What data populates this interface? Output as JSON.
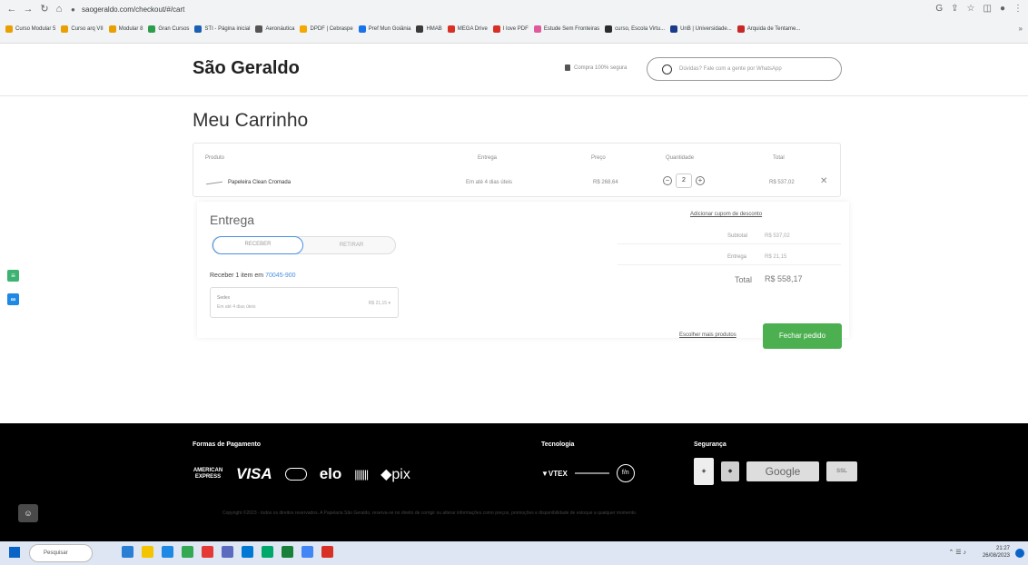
{
  "browser": {
    "url": "saogeraldo.com/checkout/#/cart",
    "bookmarks": [
      "Curso Modular 5",
      "Curso arq VII",
      "Modular 8",
      "Gran Cursos",
      "STI - Página inicial",
      "Aeronáutica",
      "DPDF | Cebraspe",
      "Pref Mun Goiânia",
      "HMAB",
      "MEGA Drive",
      "I love PDF",
      "Estude Sem Fronteiras",
      "curso, Escola Virtu...",
      "UnB | Universidade...",
      "Arquida de Tentame..."
    ],
    "bookmark_colors": [
      "#e8a000",
      "#e8a000",
      "#e8a000",
      "#2c9e4b",
      "#1a5fb4",
      "#555555",
      "#f2a900",
      "#1a73e8",
      "#3a3a3a",
      "#d93025",
      "#d93025",
      "#e05a9b",
      "#2c2c2c",
      "#1a3a8a",
      "#c62828"
    ]
  },
  "header": {
    "logo": "São Geraldo",
    "secure_text": "Compra 100% segura",
    "whatsapp_text": "Dúvidas? Fale com a gente por WhatsApp"
  },
  "cart": {
    "title": "Meu Carrinho",
    "columns": {
      "product": "Produto",
      "delivery": "Entrega",
      "price": "Preço",
      "quantity": "Quantidade",
      "total": "Total"
    },
    "item": {
      "name": "Papeleira Clean Cromada",
      "delivery": "Em até 4 dias úteis",
      "price": "R$ 268,64",
      "quantity": "2",
      "total": "R$ 537,02"
    }
  },
  "delivery": {
    "title": "Entrega",
    "option_receive": "RECEBER",
    "option_pickup": "RETIRAR",
    "receive_prefix": "Receber 1 item em",
    "zipcode": "70045-900",
    "shipping": {
      "name": "Sedex",
      "eta": "Em até 4 dias úteis",
      "price": "R$ 21,15"
    }
  },
  "summary": {
    "coupon_link": "Adicionar cupom de desconto",
    "subtotal_label": "Subtotal",
    "subtotal_value": "R$ 537,02",
    "shipping_label": "Entrega",
    "shipping_value": "R$ 21,15",
    "total_label": "Total",
    "total_value": "R$ 558,17",
    "more_products": "Escolher mais produtos",
    "checkout_button": "Fechar pedido"
  },
  "footer": {
    "payment_title": "Formas de Pagamento",
    "tech_title": "Tecnologia",
    "security_title": "Segurança",
    "amex": "AMERICAN EXPRESS",
    "visa": "VISA",
    "elo": "elo",
    "pix": "pix",
    "vtex": "VTEX",
    "fh": "f/n",
    "google": "Google",
    "ssl": "SSL",
    "copyright": "Copyright ©2023 - todos os direitos reservados. A Papelaria São Geraldo, reserva-se no direito de corrigir ou alterar informações como preços, promoções e disponibilidade de estoque a qualquer momento."
  },
  "taskbar": {
    "search_placeholder": "Pesquisar",
    "time": "21:27",
    "date": "26/08/2023",
    "app_colors": [
      "#2a7fd4",
      "#f5c400",
      "#1e88e5",
      "#34a853",
      "#e53935",
      "#5c6bc0",
      "#0078d4",
      "#00a86b",
      "#188038",
      "#4285f4",
      "#d93025"
    ]
  },
  "colors": {
    "checkout_green": "#4caf50",
    "link_blue": "#4a90e2",
    "side_cart": "#3cb371",
    "side_link": "#1e88e5"
  }
}
